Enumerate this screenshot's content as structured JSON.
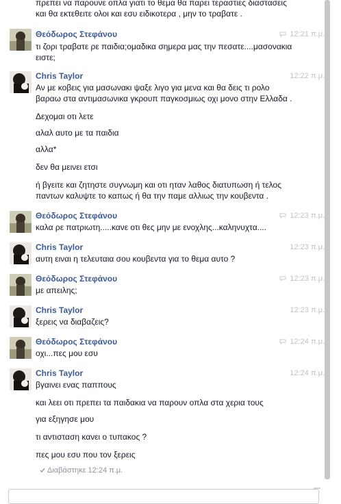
{
  "messages_top": {
    "line1": "πρεπει να παρουνε οπλα γιατι το θεμα θα παρει τεραστιες διαστασεις",
    "line2": "και θα εκτεθειτε ολοι και εσυ ειδικοτερα , μην το τραβατε ."
  },
  "blocks": [
    {
      "author": "Θεόδωρος Στεφάνου",
      "time": "12:21 π.μ.",
      "lines": [
        "τι ζορι τραβατε ρε παιδια;ομαδικα σημερα μας την πεσατε....μασονακια",
        "ειστε;"
      ]
    },
    {
      "author": "Chris Taylor",
      "time": "12:22 π.μ.",
      "lines": [
        "Αν με κοβεις για μασωνακι ψαξε λιγο για μενα και θα δεις τι ρολο",
        "βαραω στα αντιμασωνικα γκρουπ παγκοσμιως οχι μονο στην Ελλαδα .",
        "Δεχομαι οτι λετε",
        "αλαλ αυτο με τα παιδια",
        "αλλα*",
        "δεν θα μεινει ετσι",
        "ή βγειτε και ζητηστε συγνωμη και οτι ηταν λαθος διατυπωση ή τελος",
        "παντων καλυψτε το καπως ή θα την παμε αλλιως την κουβεντα ."
      ]
    },
    {
      "author": "Θεόδωρος Στεφάνου",
      "time": "12:23 π.μ.",
      "lines": [
        "καλα ρε πατριωτη.....κανε οτι θες μην με ενοχλης...καληνυχτα...."
      ]
    },
    {
      "author": "Chris Taylor",
      "time": "12:23 π.μ.",
      "lines": [
        "αυτη ειναι η τελευταια σου κουβεντα για το θεμα αυτο ?"
      ]
    },
    {
      "author": "Θεόδωρος Στεφάνου",
      "time": "12:23 π.μ.",
      "lines": [
        "με απειλης;"
      ]
    },
    {
      "author": "Chris Taylor",
      "time": "12:23 π.μ.",
      "lines": [
        "ξερεις να διαβαζεις?"
      ]
    },
    {
      "author": "Θεόδωρος Στεφάνου",
      "time": "12:24 π.μ.",
      "lines": [
        "οχι...πες μου εσυ"
      ]
    },
    {
      "author": "Chris Taylor",
      "time": "12:24 π.μ.",
      "lines": [
        "βγαινει ενας παππους",
        "και λεει οτι πρεπει τα παιδακια να παρουν οπλα στα χερια τους",
        "για εξηγησε μου",
        "τι αντισταση κανει ο τυπακος ?",
        "πες μου εσυ που τον ξερεις"
      ]
    }
  ],
  "seen_status": "Διαβάστηκε 12:24 π.μ.",
  "icons": {
    "reply": "reply-icon",
    "check": "check-icon"
  },
  "colors": {
    "author": "#3b5998",
    "time": "#bec3c9",
    "text": "#141823",
    "seen": "#90949c",
    "scrollbar": "#c7c7c7"
  }
}
